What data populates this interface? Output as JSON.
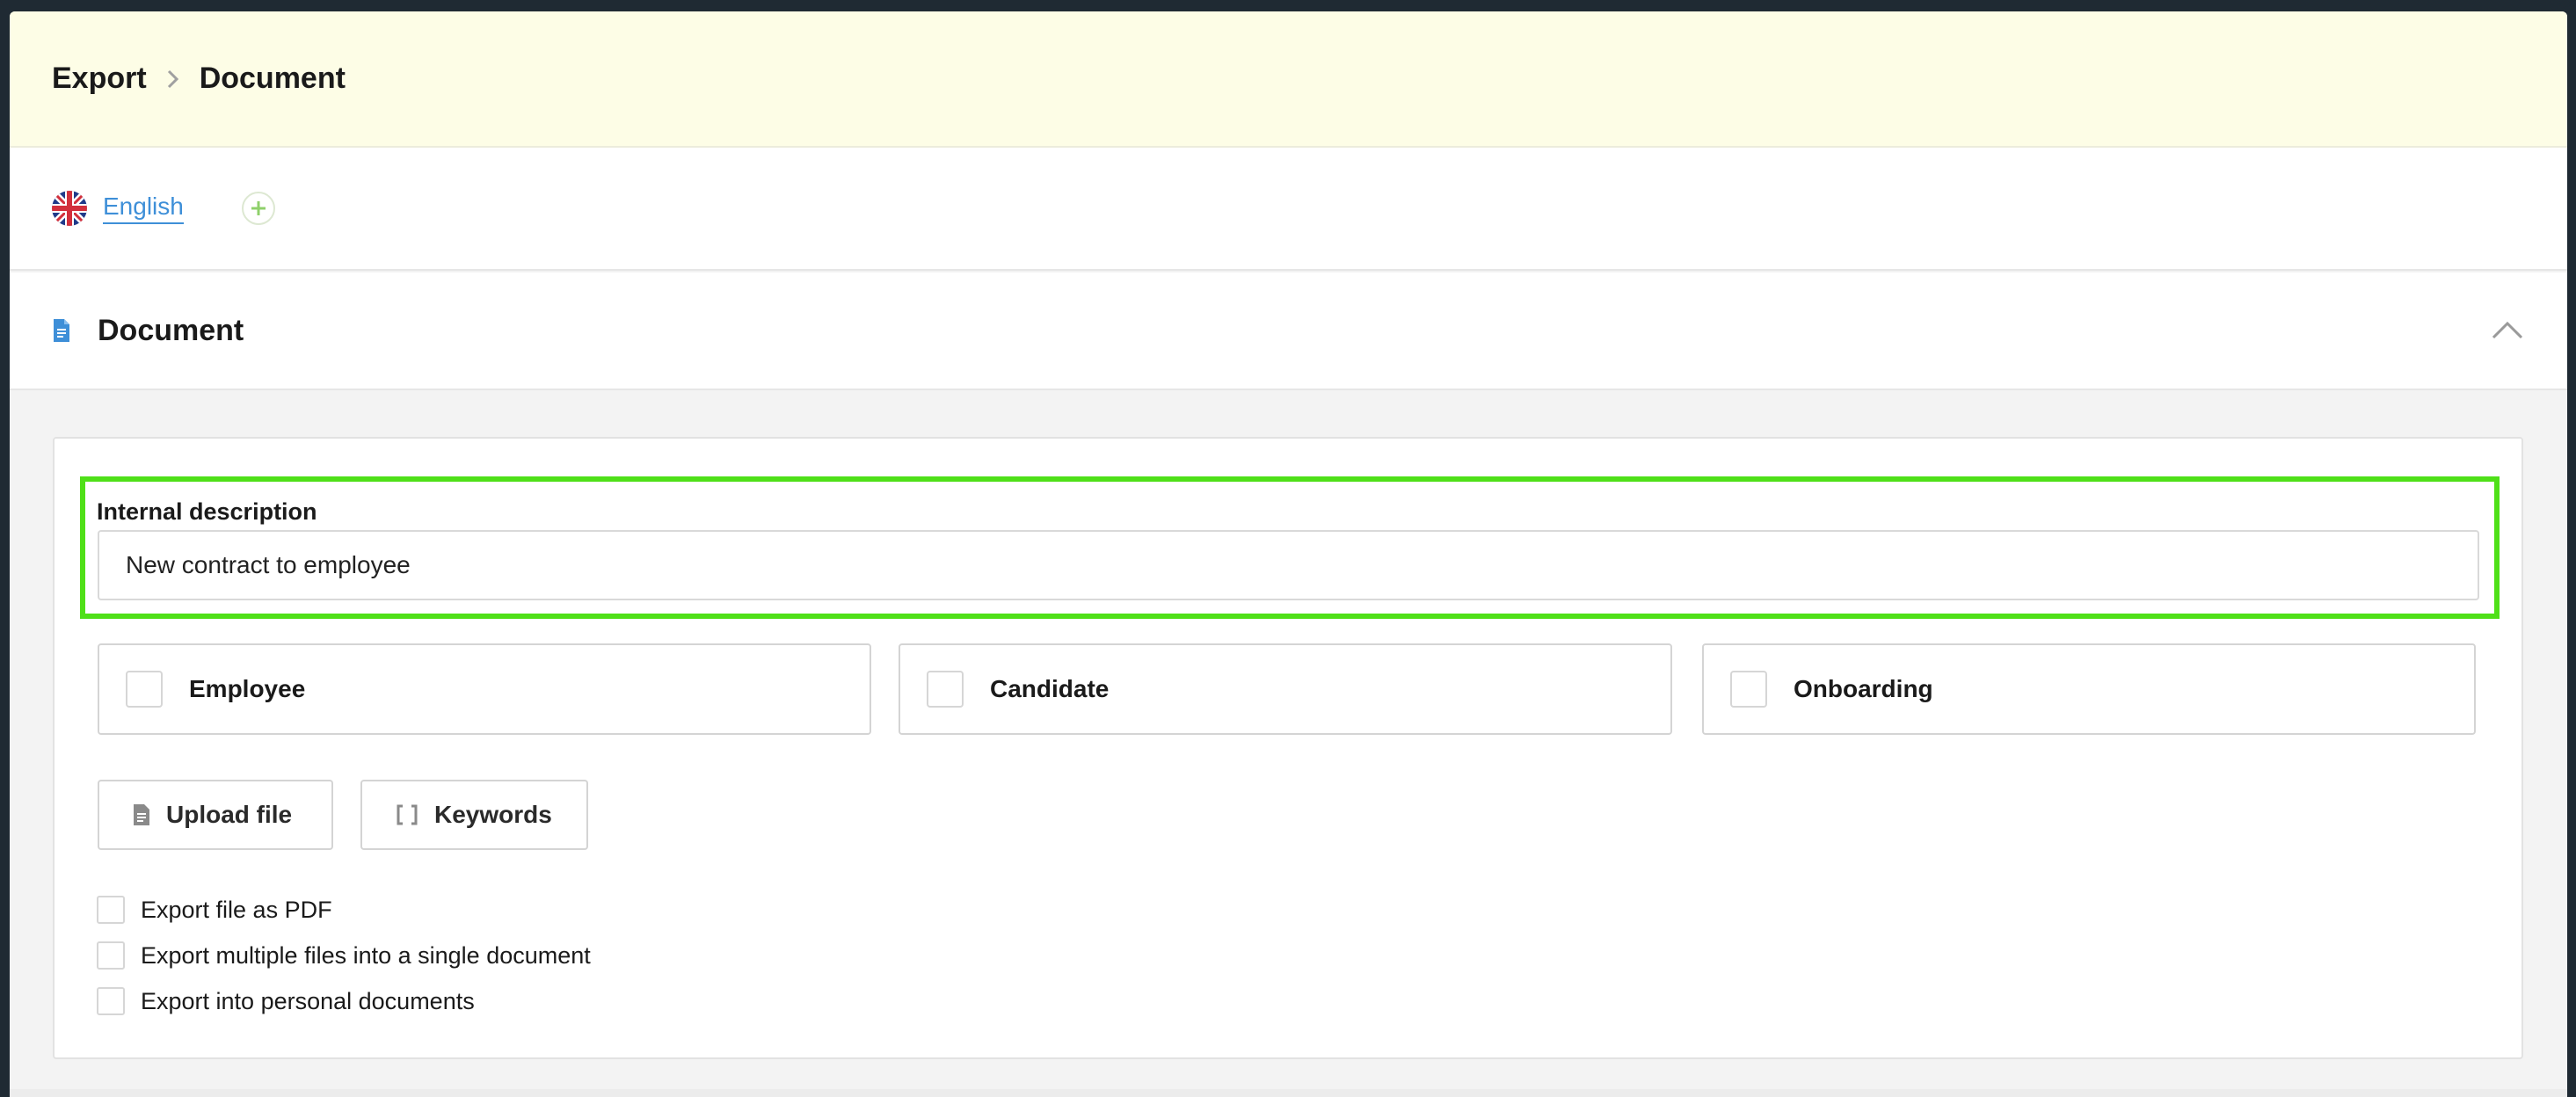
{
  "header": {
    "breadcrumb": [
      "Export",
      "Document"
    ]
  },
  "language": {
    "current": "English",
    "flag_icon": "uk-flag-icon",
    "add_icon": "plus-circle-icon"
  },
  "section": {
    "title": "Document",
    "icon": "document-icon",
    "collapse_icon": "chevron-up-icon"
  },
  "form": {
    "internal_description_label": "Internal description",
    "internal_description_value": "New contract to employee",
    "types": [
      {
        "label": "Employee",
        "checked": false
      },
      {
        "label": "Candidate",
        "checked": false
      },
      {
        "label": "Onboarding",
        "checked": false
      }
    ],
    "buttons": {
      "upload": "Upload file",
      "keywords": "Keywords"
    },
    "options": [
      {
        "label": "Export file as PDF",
        "checked": false
      },
      {
        "label": "Export multiple files into a single document",
        "checked": false
      },
      {
        "label": "Export into personal documents",
        "checked": false
      }
    ]
  },
  "colors": {
    "header_bg": "#fdfde6",
    "link": "#3e8fd8",
    "highlight": "#4fe018"
  }
}
